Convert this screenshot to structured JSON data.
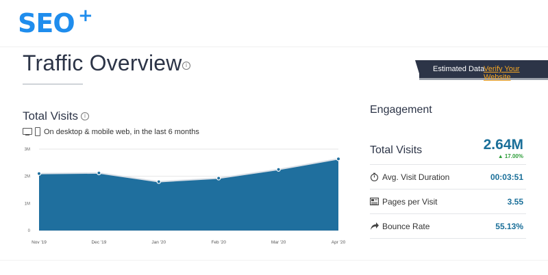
{
  "logo": {
    "text": "SEO",
    "plus": "+"
  },
  "header": {
    "title": "Traffic Overview",
    "banner_text": "Estimated Data",
    "banner_link": "Verify Your Website"
  },
  "total_visits": {
    "title": "Total Visits",
    "device_text": "On desktop & mobile web, in the last 6 months"
  },
  "chart_data": {
    "type": "area",
    "x": [
      "Nov '19",
      "Dec '19",
      "Jan '20",
      "Feb '20",
      "Mar '20",
      "Apr '20"
    ],
    "values": [
      2.1,
      2.12,
      1.8,
      1.93,
      2.25,
      2.64
    ],
    "y_ticks": [
      "0",
      "1M",
      "2M",
      "3M"
    ],
    "ylim": [
      0,
      3
    ],
    "unit": "M",
    "grid": true,
    "fill_color": "#1f6f9e"
  },
  "engagement": {
    "title": "Engagement",
    "total_label": "Total Visits",
    "total_value": "2.64M",
    "total_change": "17.00%",
    "rows": [
      {
        "label": "Avg. Visit Duration",
        "value": "00:03:51",
        "icon": "stopwatch-icon"
      },
      {
        "label": "Pages per Visit",
        "value": "3.55",
        "icon": "pages-icon"
      },
      {
        "label": "Bounce Rate",
        "value": "55.13%",
        "icon": "bounce-arrow-icon"
      }
    ]
  },
  "colors": {
    "brand": "#1f8ded",
    "dark": "#2c3447",
    "accent_link": "#f5a623",
    "value_blue": "#1a6f99",
    "positive": "#2e9e3a"
  }
}
